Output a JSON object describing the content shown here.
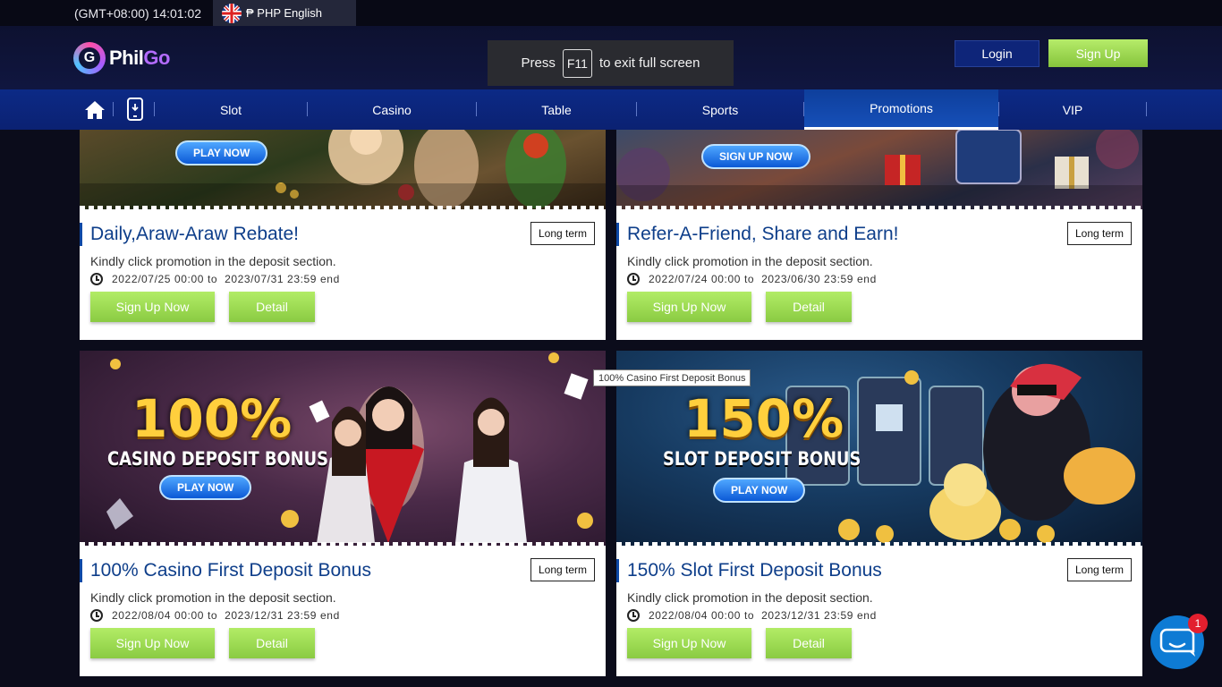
{
  "topbar": {
    "clock": "(GMT+08:00) 14:01:02",
    "language": "₱ PHP English"
  },
  "header": {
    "logo_prefix": "Phil",
    "logo_suffix": "Go",
    "fullscreen_press": "Press",
    "fullscreen_key": "F11",
    "fullscreen_rest": "to exit full screen",
    "login_label": "Login",
    "signup_label": "Sign Up"
  },
  "nav": {
    "items": [
      "Slot",
      "Casino",
      "Table",
      "Sports",
      "Promotions",
      "VIP"
    ],
    "active": "Promotions"
  },
  "promotions": [
    {
      "title": "Daily,Araw-Araw Rebate!",
      "term": "Long term",
      "description": "Kindly click promotion in the deposit section.",
      "start": "2022/07/25 00:00",
      "to": "to",
      "end": "2023/07/31 23:59",
      "end_word": "end",
      "signup_label": "Sign Up Now",
      "detail_label": "Detail",
      "banner_button": "PLAY NOW"
    },
    {
      "title": "Refer-A-Friend, Share and Earn!",
      "term": "Long term",
      "description": "Kindly click promotion in the deposit section.",
      "start": "2022/07/24 00:00",
      "to": "to",
      "end": "2023/06/30 23:59",
      "end_word": "end",
      "signup_label": "Sign Up Now",
      "detail_label": "Detail",
      "banner_button": "SIGN UP NOW"
    },
    {
      "title": "100% Casino First Deposit Bonus",
      "term": "Long term",
      "description": "Kindly click promotion in the deposit section.",
      "start": "2022/08/04 00:00",
      "to": "to",
      "end": "2023/12/31 23:59",
      "end_word": "end",
      "signup_label": "Sign Up Now",
      "detail_label": "Detail",
      "banner_heading": "100%",
      "banner_subheading": "CASINO DEPOSIT BONUS",
      "banner_button": "PLAY NOW"
    },
    {
      "title": "150% Slot First Deposit Bonus",
      "term": "Long term",
      "description": "Kindly click promotion in the deposit section.",
      "start": "2022/08/04 00:00",
      "to": "to",
      "end": "2023/12/31 23:59",
      "end_word": "end",
      "signup_label": "Sign Up Now",
      "detail_label": "Detail",
      "banner_heading": "150%",
      "banner_subheading": "SLOT DEPOSIT BONUS",
      "banner_button": "PLAY NOW"
    }
  ],
  "tooltip": "100% Casino First Deposit Bonus",
  "chat": {
    "badge_count": "1"
  },
  "colors": {
    "accent_green": "#9bdb52",
    "nav_blue": "#0b2172",
    "title_blue": "#0e3e8a",
    "login_blue": "#0e2579"
  }
}
